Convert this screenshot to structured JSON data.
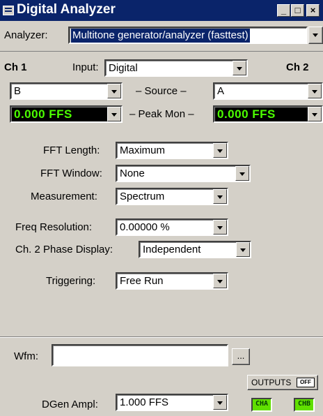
{
  "window": {
    "title": "Digital Analyzer",
    "minimize": "_",
    "maximize": "□",
    "close": "×"
  },
  "analyzer": {
    "label": "Analyzer:",
    "value": "Multitone generator/analyzer (fasttest)"
  },
  "channels": {
    "ch1_label": "Ch 1",
    "input_label": "Input:",
    "input_value": "Digital",
    "ch2_label": "Ch 2",
    "source_label": "– Source –",
    "source_ch1": "B",
    "source_ch2": "A",
    "peak_label": "– Peak Mon –",
    "peak_ch1": "0.000   FFS",
    "peak_ch2": "0.000   FFS"
  },
  "settings": {
    "fft_length_label": "FFT Length:",
    "fft_length_value": "Maximum",
    "fft_window_label": "FFT Window:",
    "fft_window_value": "None",
    "measurement_label": "Measurement:",
    "measurement_value": "Spectrum",
    "freq_res_label": "Freq Resolution:",
    "freq_res_value": "0.00000  %",
    "phase_label": "Ch. 2 Phase Display:",
    "phase_value": "Independent",
    "triggering_label": "Triggering:",
    "triggering_value": "Free Run"
  },
  "bottom": {
    "wfm_label": "Wfm:",
    "wfm_value": "",
    "browse_label": "...",
    "outputs_label": "OUTPUTS",
    "outputs_state": "OFF",
    "dgen_label": "DGen Ampl:",
    "dgen_value": "1.000   FFS",
    "cha_label": "CHA",
    "chb_label": "CHB"
  },
  "colors": {
    "titlebar": "#0a246a",
    "led_green": "#60e000",
    "meter_text": "#4cff00"
  }
}
